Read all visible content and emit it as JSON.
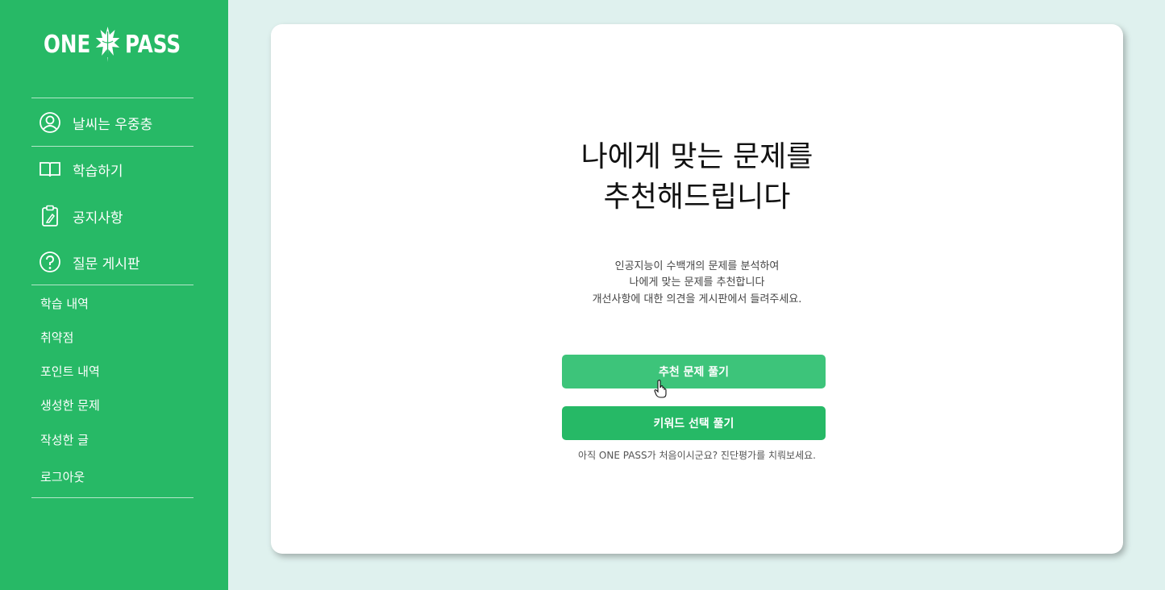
{
  "app": {
    "logo_left": "ONE",
    "logo_right": "PASS"
  },
  "sidebar": {
    "user_name": "날씨는 우중충",
    "main_items": [
      {
        "label": "학습하기",
        "icon": "book-icon"
      },
      {
        "label": "공지사항",
        "icon": "clipboard-icon"
      },
      {
        "label": "질문 게시판",
        "icon": "question-icon"
      }
    ],
    "sub_items": [
      {
        "label": "학습 내역"
      },
      {
        "label": "취약점"
      },
      {
        "label": "포인트 내역"
      },
      {
        "label": "생성한 문제"
      },
      {
        "label": "작성한 글"
      },
      {
        "label": "로그아웃"
      }
    ]
  },
  "main": {
    "headline_line1": "나에게 맞는 문제를",
    "headline_line2": "추천해드립니다",
    "desc_line1": "인공지능이 수백개의 문제를 분석하여",
    "desc_line2": "나에게 맞는 문제를 추천합니다",
    "desc_line3": "개선사항에 대한 의견을 게시판에서 들려주세요.",
    "recommend_button": "추천 문제 풀기",
    "keyword_button": "키워드 선택 풀기",
    "hint": "아직 ONE PASS가 처음이시군요? 진단평가를 치뤄보세요."
  },
  "colors": {
    "sidebar": "#27b966",
    "background": "#dff1ee",
    "button_primary": "#26b966",
    "button_hover": "#3dc47a"
  }
}
